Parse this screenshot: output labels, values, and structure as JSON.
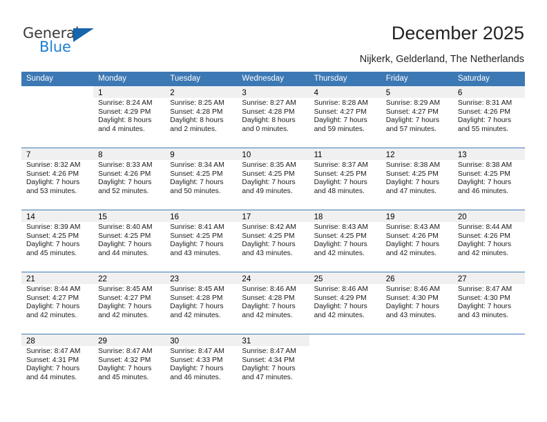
{
  "brand": {
    "name_top": "General",
    "name_bottom": "Blue",
    "accent_color": "#1c7fd4",
    "triangle_color": "#1665ad"
  },
  "header": {
    "title": "December 2025",
    "subtitle": "Nijkerk, Gelderland, The Netherlands"
  },
  "calendar": {
    "header_color": "#3c78b4",
    "weekday_headers": [
      "Sunday",
      "Monday",
      "Tuesday",
      "Wednesday",
      "Thursday",
      "Friday",
      "Saturday"
    ],
    "weeks": [
      [
        {
          "day": "",
          "sunrise": "",
          "sunset": "",
          "daylight_1": "",
          "daylight_2": ""
        },
        {
          "day": "1",
          "sunrise": "Sunrise: 8:24 AM",
          "sunset": "Sunset: 4:29 PM",
          "daylight_1": "Daylight: 8 hours",
          "daylight_2": "and 4 minutes."
        },
        {
          "day": "2",
          "sunrise": "Sunrise: 8:25 AM",
          "sunset": "Sunset: 4:28 PM",
          "daylight_1": "Daylight: 8 hours",
          "daylight_2": "and 2 minutes."
        },
        {
          "day": "3",
          "sunrise": "Sunrise: 8:27 AM",
          "sunset": "Sunset: 4:28 PM",
          "daylight_1": "Daylight: 8 hours",
          "daylight_2": "and 0 minutes."
        },
        {
          "day": "4",
          "sunrise": "Sunrise: 8:28 AM",
          "sunset": "Sunset: 4:27 PM",
          "daylight_1": "Daylight: 7 hours",
          "daylight_2": "and 59 minutes."
        },
        {
          "day": "5",
          "sunrise": "Sunrise: 8:29 AM",
          "sunset": "Sunset: 4:27 PM",
          "daylight_1": "Daylight: 7 hours",
          "daylight_2": "and 57 minutes."
        },
        {
          "day": "6",
          "sunrise": "Sunrise: 8:31 AM",
          "sunset": "Sunset: 4:26 PM",
          "daylight_1": "Daylight: 7 hours",
          "daylight_2": "and 55 minutes."
        }
      ],
      [
        {
          "day": "7",
          "sunrise": "Sunrise: 8:32 AM",
          "sunset": "Sunset: 4:26 PM",
          "daylight_1": "Daylight: 7 hours",
          "daylight_2": "and 53 minutes."
        },
        {
          "day": "8",
          "sunrise": "Sunrise: 8:33 AM",
          "sunset": "Sunset: 4:26 PM",
          "daylight_1": "Daylight: 7 hours",
          "daylight_2": "and 52 minutes."
        },
        {
          "day": "9",
          "sunrise": "Sunrise: 8:34 AM",
          "sunset": "Sunset: 4:25 PM",
          "daylight_1": "Daylight: 7 hours",
          "daylight_2": "and 50 minutes."
        },
        {
          "day": "10",
          "sunrise": "Sunrise: 8:35 AM",
          "sunset": "Sunset: 4:25 PM",
          "daylight_1": "Daylight: 7 hours",
          "daylight_2": "and 49 minutes."
        },
        {
          "day": "11",
          "sunrise": "Sunrise: 8:37 AM",
          "sunset": "Sunset: 4:25 PM",
          "daylight_1": "Daylight: 7 hours",
          "daylight_2": "and 48 minutes."
        },
        {
          "day": "12",
          "sunrise": "Sunrise: 8:38 AM",
          "sunset": "Sunset: 4:25 PM",
          "daylight_1": "Daylight: 7 hours",
          "daylight_2": "and 47 minutes."
        },
        {
          "day": "13",
          "sunrise": "Sunrise: 8:38 AM",
          "sunset": "Sunset: 4:25 PM",
          "daylight_1": "Daylight: 7 hours",
          "daylight_2": "and 46 minutes."
        }
      ],
      [
        {
          "day": "14",
          "sunrise": "Sunrise: 8:39 AM",
          "sunset": "Sunset: 4:25 PM",
          "daylight_1": "Daylight: 7 hours",
          "daylight_2": "and 45 minutes."
        },
        {
          "day": "15",
          "sunrise": "Sunrise: 8:40 AM",
          "sunset": "Sunset: 4:25 PM",
          "daylight_1": "Daylight: 7 hours",
          "daylight_2": "and 44 minutes."
        },
        {
          "day": "16",
          "sunrise": "Sunrise: 8:41 AM",
          "sunset": "Sunset: 4:25 PM",
          "daylight_1": "Daylight: 7 hours",
          "daylight_2": "and 43 minutes."
        },
        {
          "day": "17",
          "sunrise": "Sunrise: 8:42 AM",
          "sunset": "Sunset: 4:25 PM",
          "daylight_1": "Daylight: 7 hours",
          "daylight_2": "and 43 minutes."
        },
        {
          "day": "18",
          "sunrise": "Sunrise: 8:43 AM",
          "sunset": "Sunset: 4:25 PM",
          "daylight_1": "Daylight: 7 hours",
          "daylight_2": "and 42 minutes."
        },
        {
          "day": "19",
          "sunrise": "Sunrise: 8:43 AM",
          "sunset": "Sunset: 4:26 PM",
          "daylight_1": "Daylight: 7 hours",
          "daylight_2": "and 42 minutes."
        },
        {
          "day": "20",
          "sunrise": "Sunrise: 8:44 AM",
          "sunset": "Sunset: 4:26 PM",
          "daylight_1": "Daylight: 7 hours",
          "daylight_2": "and 42 minutes."
        }
      ],
      [
        {
          "day": "21",
          "sunrise": "Sunrise: 8:44 AM",
          "sunset": "Sunset: 4:27 PM",
          "daylight_1": "Daylight: 7 hours",
          "daylight_2": "and 42 minutes."
        },
        {
          "day": "22",
          "sunrise": "Sunrise: 8:45 AM",
          "sunset": "Sunset: 4:27 PM",
          "daylight_1": "Daylight: 7 hours",
          "daylight_2": "and 42 minutes."
        },
        {
          "day": "23",
          "sunrise": "Sunrise: 8:45 AM",
          "sunset": "Sunset: 4:28 PM",
          "daylight_1": "Daylight: 7 hours",
          "daylight_2": "and 42 minutes."
        },
        {
          "day": "24",
          "sunrise": "Sunrise: 8:46 AM",
          "sunset": "Sunset: 4:28 PM",
          "daylight_1": "Daylight: 7 hours",
          "daylight_2": "and 42 minutes."
        },
        {
          "day": "25",
          "sunrise": "Sunrise: 8:46 AM",
          "sunset": "Sunset: 4:29 PM",
          "daylight_1": "Daylight: 7 hours",
          "daylight_2": "and 42 minutes."
        },
        {
          "day": "26",
          "sunrise": "Sunrise: 8:46 AM",
          "sunset": "Sunset: 4:30 PM",
          "daylight_1": "Daylight: 7 hours",
          "daylight_2": "and 43 minutes."
        },
        {
          "day": "27",
          "sunrise": "Sunrise: 8:47 AM",
          "sunset": "Sunset: 4:30 PM",
          "daylight_1": "Daylight: 7 hours",
          "daylight_2": "and 43 minutes."
        }
      ],
      [
        {
          "day": "28",
          "sunrise": "Sunrise: 8:47 AM",
          "sunset": "Sunset: 4:31 PM",
          "daylight_1": "Daylight: 7 hours",
          "daylight_2": "and 44 minutes."
        },
        {
          "day": "29",
          "sunrise": "Sunrise: 8:47 AM",
          "sunset": "Sunset: 4:32 PM",
          "daylight_1": "Daylight: 7 hours",
          "daylight_2": "and 45 minutes."
        },
        {
          "day": "30",
          "sunrise": "Sunrise: 8:47 AM",
          "sunset": "Sunset: 4:33 PM",
          "daylight_1": "Daylight: 7 hours",
          "daylight_2": "and 46 minutes."
        },
        {
          "day": "31",
          "sunrise": "Sunrise: 8:47 AM",
          "sunset": "Sunset: 4:34 PM",
          "daylight_1": "Daylight: 7 hours",
          "daylight_2": "and 47 minutes."
        },
        {
          "day": "",
          "sunrise": "",
          "sunset": "",
          "daylight_1": "",
          "daylight_2": ""
        },
        {
          "day": "",
          "sunrise": "",
          "sunset": "",
          "daylight_1": "",
          "daylight_2": ""
        },
        {
          "day": "",
          "sunrise": "",
          "sunset": "",
          "daylight_1": "",
          "daylight_2": ""
        }
      ]
    ]
  }
}
